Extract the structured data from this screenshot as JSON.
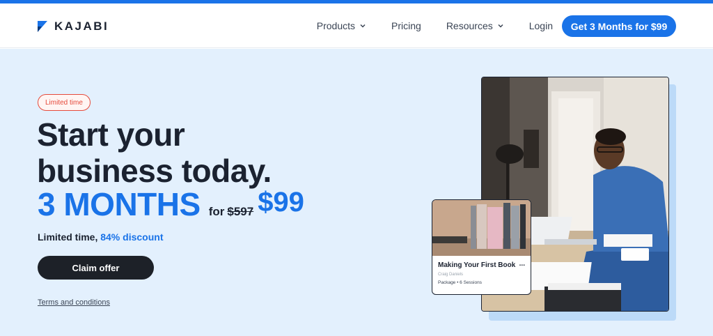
{
  "header": {
    "logo_text": "KAJABI",
    "nav": [
      {
        "label": "Products",
        "dropdown": true
      },
      {
        "label": "Pricing",
        "dropdown": false
      },
      {
        "label": "Resources",
        "dropdown": true
      },
      {
        "label": "Login",
        "dropdown": false
      }
    ],
    "cta_label": "Get 3 Months for $99"
  },
  "hero": {
    "badge": "Limited time",
    "headline_line1": "Start your",
    "headline_line2": "business today.",
    "months": "3 MONTHS",
    "for_label": "for",
    "old_price": "$597",
    "new_price": "$99",
    "discount_prefix": "Limited time, ",
    "discount_value": "84% discount",
    "claim_label": "Claim offer",
    "terms_label": "Terms and conditions"
  },
  "product_card": {
    "title": "Making Your First Book",
    "author": "Craig Daniels",
    "meta": "Package • 6 Sessions",
    "menu": "..."
  },
  "colors": {
    "accent": "#1a73e8",
    "badge": "#e64a3b",
    "hero_bg": "#e3f0fd",
    "dark": "#1b2230"
  }
}
